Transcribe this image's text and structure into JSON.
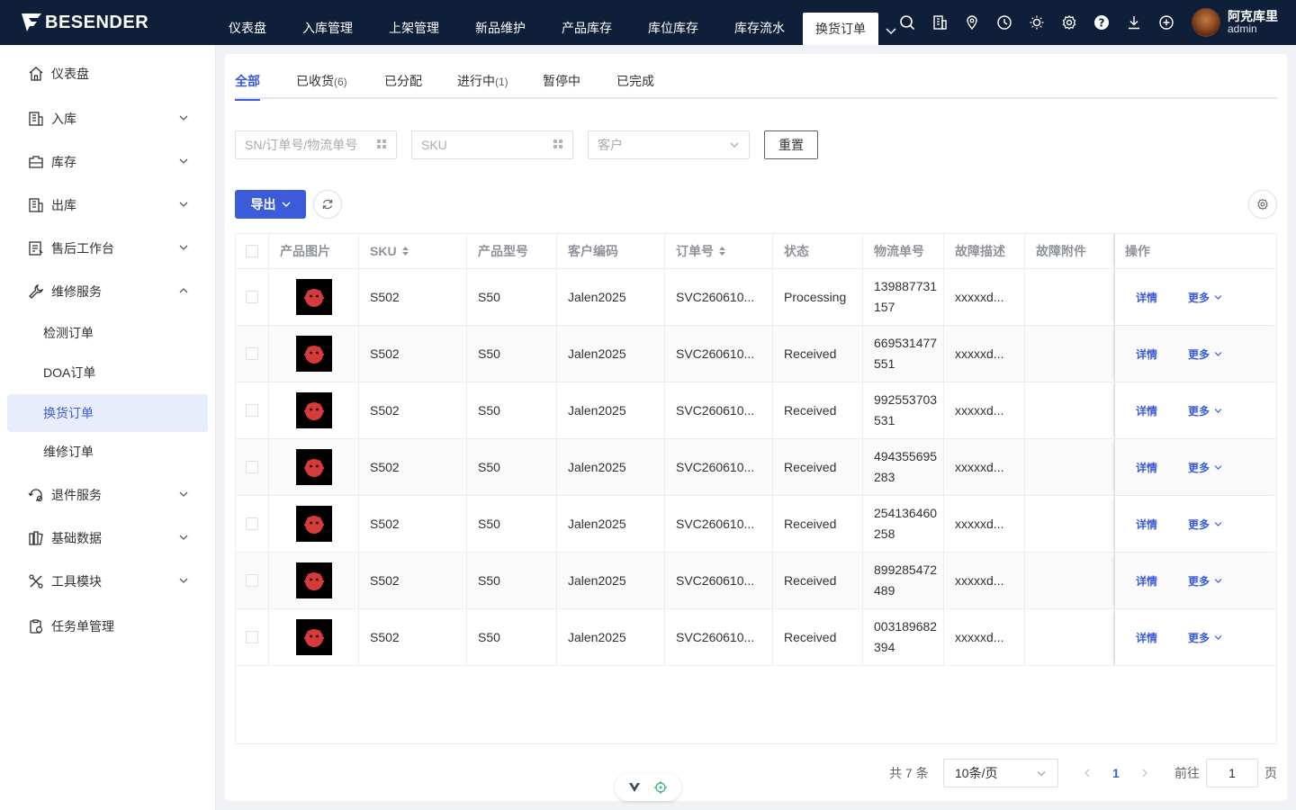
{
  "brand": "BESENDER",
  "topnav": [
    {
      "label": "仪表盘"
    },
    {
      "label": "入库管理"
    },
    {
      "label": "上架管理"
    },
    {
      "label": "新品维护"
    },
    {
      "label": "产品库存"
    },
    {
      "label": "库位库存"
    },
    {
      "label": "库存流水"
    },
    {
      "label": "换货订单",
      "active": true
    }
  ],
  "top_icons": [
    "search-icon",
    "building-icon",
    "location-pin-icon",
    "clock-icon",
    "sun-icon",
    "gear-icon",
    "help-icon",
    "download-icon",
    "add-circle-icon"
  ],
  "user": {
    "name": "阿克库里",
    "role": "admin"
  },
  "sidebar": {
    "items": [
      {
        "label": "仪表盘",
        "icon": "home-icon"
      },
      {
        "label": "入库",
        "icon": "inbound-icon"
      },
      {
        "label": "库存",
        "icon": "inventory-icon"
      },
      {
        "label": "出库",
        "icon": "outbound-icon"
      },
      {
        "label": "售后工作台",
        "icon": "aftersales-icon"
      },
      {
        "label": "维修服务",
        "icon": "wrench-icon"
      },
      {
        "label": "退件服务",
        "icon": "return-icon"
      },
      {
        "label": "基础数据",
        "icon": "database-icon"
      },
      {
        "label": "工具模块",
        "icon": "tools-icon"
      },
      {
        "label": "任务单管理",
        "icon": "task-icon"
      }
    ],
    "subitems": [
      {
        "label": "检测订单"
      },
      {
        "label": "DOA订单"
      },
      {
        "label": "换货订单",
        "active": true
      },
      {
        "label": "维修订单"
      }
    ]
  },
  "tabs": [
    {
      "label": "全部",
      "count": ""
    },
    {
      "label": "已收货",
      "count": "(6)"
    },
    {
      "label": "已分配",
      "count": ""
    },
    {
      "label": "进行中",
      "count": "(1)"
    },
    {
      "label": "暂停中",
      "count": ""
    },
    {
      "label": "已完成",
      "count": ""
    }
  ],
  "filters": {
    "sn_placeholder": "SN/订单号/物流单号",
    "sku_placeholder": "SKU",
    "customer_placeholder": "客户",
    "reset_label": "重置"
  },
  "toolbar": {
    "export_label": "导出"
  },
  "table": {
    "headers": {
      "image": "产品图片",
      "sku": "SKU",
      "model": "产品型号",
      "customer_code": "客户编码",
      "order_no": "订单号",
      "status": "状态",
      "tracking_no": "物流单号",
      "fault_desc": "故障描述",
      "fault_attachment": "故障附件",
      "actions": "操作"
    },
    "detail_label": "详情",
    "more_label": "更多",
    "rows": [
      {
        "sku": "S502",
        "model": "S50",
        "customer_code": "Jalen2025",
        "order_no": "SVC260610...",
        "status": "Processing",
        "tracking_no": "139887731157",
        "fault_desc": "xxxxxd..."
      },
      {
        "sku": "S502",
        "model": "S50",
        "customer_code": "Jalen2025",
        "order_no": "SVC260610...",
        "status": "Received",
        "tracking_no": "669531477551",
        "fault_desc": "xxxxxd..."
      },
      {
        "sku": "S502",
        "model": "S50",
        "customer_code": "Jalen2025",
        "order_no": "SVC260610...",
        "status": "Received",
        "tracking_no": "992553703531",
        "fault_desc": "xxxxxd..."
      },
      {
        "sku": "S502",
        "model": "S50",
        "customer_code": "Jalen2025",
        "order_no": "SVC260610...",
        "status": "Received",
        "tracking_no": "494355695283",
        "fault_desc": "xxxxxd..."
      },
      {
        "sku": "S502",
        "model": "S50",
        "customer_code": "Jalen2025",
        "order_no": "SVC260610...",
        "status": "Received",
        "tracking_no": "254136460258",
        "fault_desc": "xxxxxd..."
      },
      {
        "sku": "S502",
        "model": "S50",
        "customer_code": "Jalen2025",
        "order_no": "SVC260610...",
        "status": "Received",
        "tracking_no": "899285472489",
        "fault_desc": "xxxxxd..."
      },
      {
        "sku": "S502",
        "model": "S50",
        "customer_code": "Jalen2025",
        "order_no": "SVC260610...",
        "status": "Received",
        "tracking_no": "003189682394",
        "fault_desc": "xxxxxd..."
      }
    ]
  },
  "pagination": {
    "total_label": "共 7 条",
    "page_size": "10条/页",
    "current_page": "1",
    "goto_label": "前往",
    "goto_value": "1",
    "page_suffix": "页"
  },
  "colors": {
    "topbar": "#0f1f3a",
    "accent": "#3b5bdb"
  }
}
